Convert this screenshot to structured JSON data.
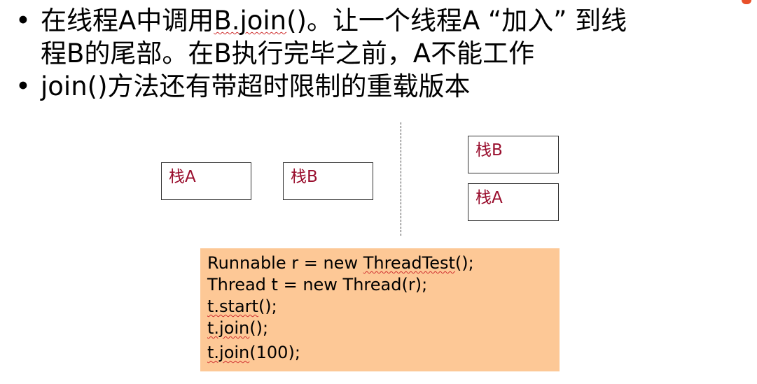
{
  "bullets": [
    {
      "line1_a": "在线程A中调用",
      "line1_b": "B.join",
      "line1_c": "()。让一个线程A “加入” 到线",
      "line2": "程B的尾部。在B执行完毕之前，A不能工作"
    },
    {
      "line1": "join()方法还有带超时限制的重载版本"
    }
  ],
  "bullet_glyph": "•",
  "stacks": {
    "left": "栈A",
    "middle": "栈B",
    "right_top": "栈B",
    "right_bottom": "栈A"
  },
  "code": {
    "line1_prefix": "Runnable r = new ",
    "line1_class": "ThreadTest",
    "line1_suffix": "();",
    "line2": "Thread t = new Thread(r);",
    "line3_call": "t.start",
    "line3_suffix": "();",
    "line4_call": "t.join",
    "line4_suffix": "();",
    "line5_call": "t.join",
    "line5_suffix": "(100);"
  },
  "colors": {
    "stack_label": "#9a0f2e",
    "code_background": "#fdc896",
    "spellcheck_underline": "#d03030"
  }
}
